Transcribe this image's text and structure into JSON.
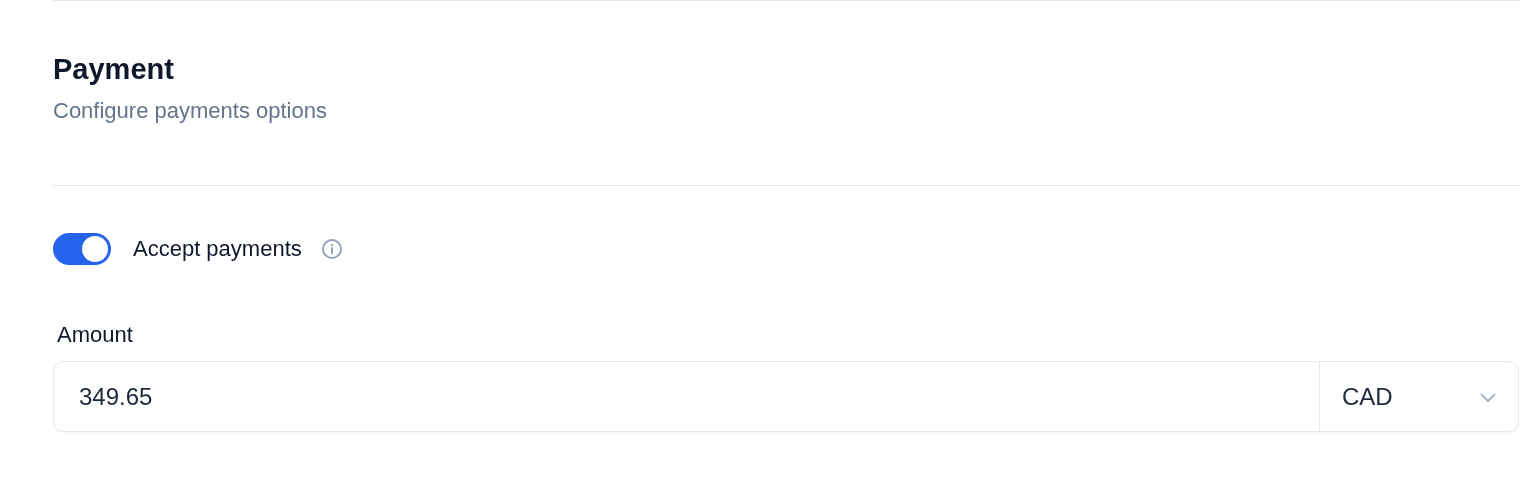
{
  "section": {
    "title": "Payment",
    "description": "Configure payments options"
  },
  "toggle": {
    "label": "Accept payments",
    "on": true
  },
  "amount": {
    "label": "Amount",
    "value": "349.65",
    "currency": "CAD"
  }
}
